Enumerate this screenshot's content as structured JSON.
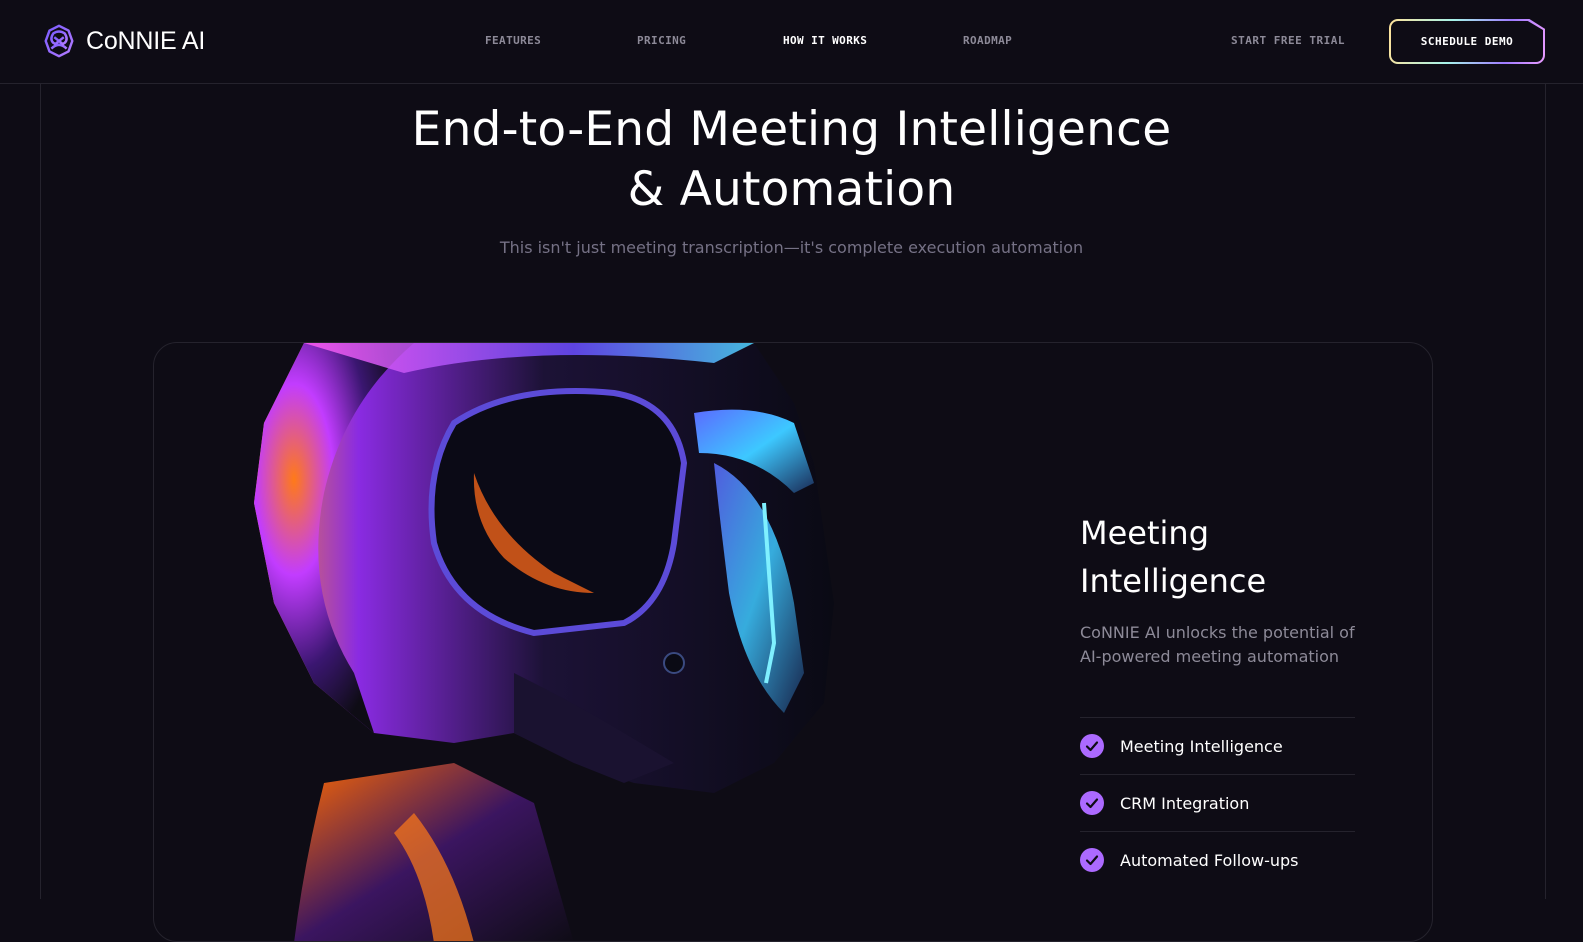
{
  "brand": {
    "name": "CoNNIE AI",
    "logo_icon": "brain-knot-icon"
  },
  "nav": {
    "items": [
      {
        "label": "FEATURES",
        "active": false
      },
      {
        "label": "PRICING",
        "active": false
      },
      {
        "label": "HOW IT WORKS",
        "active": true
      },
      {
        "label": "ROADMAP",
        "active": false
      }
    ],
    "start_trial_label": "START FREE TRIAL",
    "schedule_demo_label": "SCHEDULE DEMO"
  },
  "hero": {
    "title_line1": "End-to-End Meeting Intelligence",
    "title_line2": "& Automation",
    "subtitle": "This isn't just meeting transcription—it's complete execution automation"
  },
  "card": {
    "image_icon": "robot-helmet-illustration",
    "title_line1": "Meeting",
    "title_line2": "Intelligence",
    "description": "CoNNIE AI unlocks the potential of AI-powered meeting automation",
    "features": [
      {
        "label": "Meeting Intelligence",
        "icon": "check-circle-icon"
      },
      {
        "label": "CRM Integration",
        "icon": "check-circle-icon"
      },
      {
        "label": "Automated Follow-ups",
        "icon": "check-circle-icon"
      }
    ]
  },
  "colors": {
    "background": "#0e0c15",
    "border": "#25232d",
    "muted_text": "#8d8a98",
    "accent_purple": "#ac6aff"
  }
}
